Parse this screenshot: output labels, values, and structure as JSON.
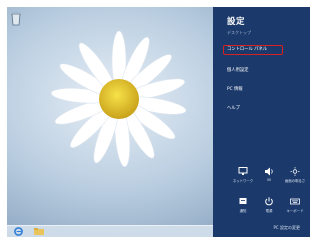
{
  "charm": {
    "title": "設定",
    "subtitle": "デスクトップ",
    "menu": [
      {
        "label": "コントロール パネル",
        "highlighted": true
      },
      {
        "label": "個人用設定",
        "highlighted": false
      },
      {
        "label": "PC 情報",
        "highlighted": false
      },
      {
        "label": "ヘルプ",
        "highlighted": false
      }
    ],
    "tiles": [
      {
        "label": "ネットワーク",
        "icon": "network-icon"
      },
      {
        "label": "50",
        "icon": "volume-icon"
      },
      {
        "label": "画面の明るさ",
        "icon": "brightness-icon"
      },
      {
        "label": "通知",
        "icon": "notifications-icon"
      },
      {
        "label": "電源",
        "icon": "power-icon"
      },
      {
        "label": "キーボード",
        "icon": "keyboard-icon"
      }
    ],
    "footer": "PC 設定の変更"
  },
  "colors": {
    "charm_background": "#1b3a6b",
    "highlight_border": "#d8201f"
  }
}
